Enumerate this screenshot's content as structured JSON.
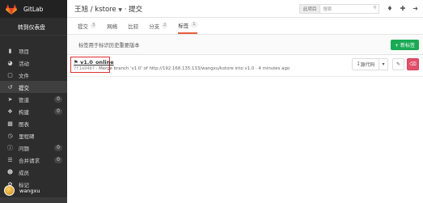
{
  "sidebar": {
    "brand": "GitLab",
    "back_link": "转到仪表盘",
    "items": [
      {
        "label": "项目",
        "icon": "bookmark-icon",
        "count": ""
      },
      {
        "label": "活动",
        "icon": "dashboard-icon",
        "count": ""
      },
      {
        "label": "文件",
        "icon": "files-icon",
        "count": ""
      },
      {
        "label": "提交",
        "icon": "history-icon",
        "count": ""
      },
      {
        "label": "管道",
        "icon": "rocket-icon",
        "count": "0"
      },
      {
        "label": "构建",
        "icon": "cubes-icon",
        "count": "0"
      },
      {
        "label": "图表",
        "icon": "chart-icon",
        "count": ""
      },
      {
        "label": "里程碑",
        "icon": "clock-icon",
        "count": ""
      },
      {
        "label": "问题",
        "icon": "exclamation-icon",
        "count": "0"
      },
      {
        "label": "合并请求",
        "icon": "list-icon",
        "count": "0"
      },
      {
        "label": "成员",
        "icon": "users-icon",
        "count": ""
      },
      {
        "label": "标记",
        "icon": "tags-icon",
        "count": ""
      }
    ],
    "user": "wangxu"
  },
  "header": {
    "breadcrumb_owner": "王旭",
    "breadcrumb_sep": "/",
    "breadcrumb_project": "kstore",
    "breadcrumb_page": "提交",
    "search_scope": "此项目",
    "search_placeholder": "搜索"
  },
  "tabs": [
    {
      "label": "提交",
      "count": "3"
    },
    {
      "label": "网络",
      "count": ""
    },
    {
      "label": "比较",
      "count": ""
    },
    {
      "label": "分支",
      "count": "2"
    },
    {
      "label": "标签",
      "count": "1"
    }
  ],
  "infobar": {
    "text": "标签用于标识历史重要版本",
    "new_tag_label": "+ 新标签"
  },
  "tag": {
    "name": "v1.0_online",
    "sha": "7f1a9487",
    "message": " · Merge branch 'v1.0' of http://192.168.135.133/wangxu/kstore into v1.0 · 4 minutes ago",
    "source_label": "源代码"
  }
}
